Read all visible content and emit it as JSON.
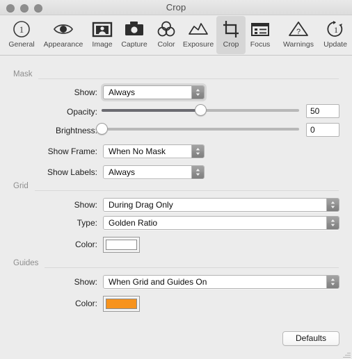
{
  "window": {
    "title": "Crop",
    "traffic_lights": [
      "close",
      "minimize",
      "maximize"
    ]
  },
  "toolbar": {
    "selected": "Crop",
    "items": [
      {
        "label": "General",
        "icon": "numbered-circle-one-icon"
      },
      {
        "label": "Appearance",
        "icon": "eye-icon"
      },
      {
        "label": "Image",
        "icon": "portrait-frame-icon"
      },
      {
        "label": "Capture",
        "icon": "camera-icon"
      },
      {
        "label": "Color",
        "icon": "three-circles-venn-icon"
      },
      {
        "label": "Exposure",
        "icon": "histogram-curve-icon"
      },
      {
        "label": "Crop",
        "icon": "crop-marks-icon"
      },
      {
        "label": "Focus",
        "icon": "focus-panel-icon"
      },
      {
        "label": "Warnings",
        "icon": "warning-triangle-question-icon"
      },
      {
        "label": "Update",
        "icon": "refresh-circle-one-icon"
      }
    ]
  },
  "sections": [
    {
      "title": "Mask",
      "rows": [
        {
          "label": "Show:",
          "control": "combo",
          "value": "Always",
          "focused": true
        },
        {
          "label": "Opacity:",
          "control": "slider",
          "value": "50",
          "percent": 50
        },
        {
          "label": "Brightness:",
          "control": "slider",
          "value": "0",
          "percent": 0
        },
        {
          "label": "Show Frame:",
          "control": "combo",
          "value": "When No Mask"
        },
        {
          "label": "Show Labels:",
          "control": "combo",
          "value": "Always"
        }
      ]
    },
    {
      "title": "Grid",
      "rows": [
        {
          "label": "Show:",
          "control": "combo",
          "value": "During Drag Only"
        },
        {
          "label": "Type:",
          "control": "combo",
          "value": "Golden Ratio"
        },
        {
          "label": "Color:",
          "control": "color",
          "swatch": "#ffffff"
        }
      ]
    },
    {
      "title": "Guides",
      "rows": [
        {
          "label": "Show:",
          "control": "combo",
          "value": "When Grid and Guides On"
        },
        {
          "label": "Color:",
          "control": "color",
          "swatch": "#f7931d"
        }
      ]
    }
  ],
  "footer": {
    "defaults_label": "Defaults"
  },
  "colors": {
    "window_background": "#ececec",
    "titlebar_top": "#e9e9e9",
    "titlebar_bottom": "#dcdcdc",
    "selected_tab_background": "#d6d6d6",
    "section_header_text": "#8d8d8d",
    "slider_fill": "#6b6b71",
    "slider_track": "#b8b8b8",
    "guides_swatch": "#f7931d",
    "grid_swatch": "#ffffff"
  }
}
